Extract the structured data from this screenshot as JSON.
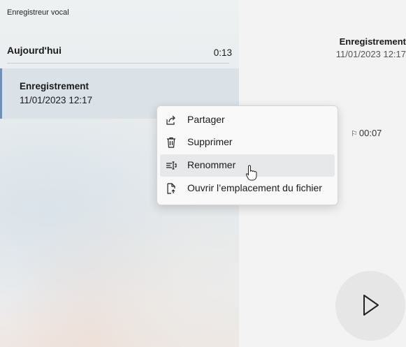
{
  "app": {
    "title": "Enregistreur vocal"
  },
  "list": {
    "section_title": "Aujourd'hui",
    "items": [
      {
        "name": "Enregistrement",
        "date": "11/01/2023 12:17",
        "duration": "0:13"
      }
    ]
  },
  "detail": {
    "name": "Enregistrement",
    "date": "11/01/2023 12:17",
    "marker_time": "00:07"
  },
  "context_menu": {
    "items": [
      {
        "label": "Partager",
        "icon": "share-icon"
      },
      {
        "label": "Supprimer",
        "icon": "trash-icon"
      },
      {
        "label": "Renommer",
        "icon": "rename-icon",
        "hovered": true
      },
      {
        "label": "Ouvrir l’emplacement du fichier",
        "icon": "file-open-location-icon"
      }
    ]
  },
  "colors": {
    "selection_accent": "#6f8fb8",
    "menu_hover": "#e7e8ea"
  }
}
